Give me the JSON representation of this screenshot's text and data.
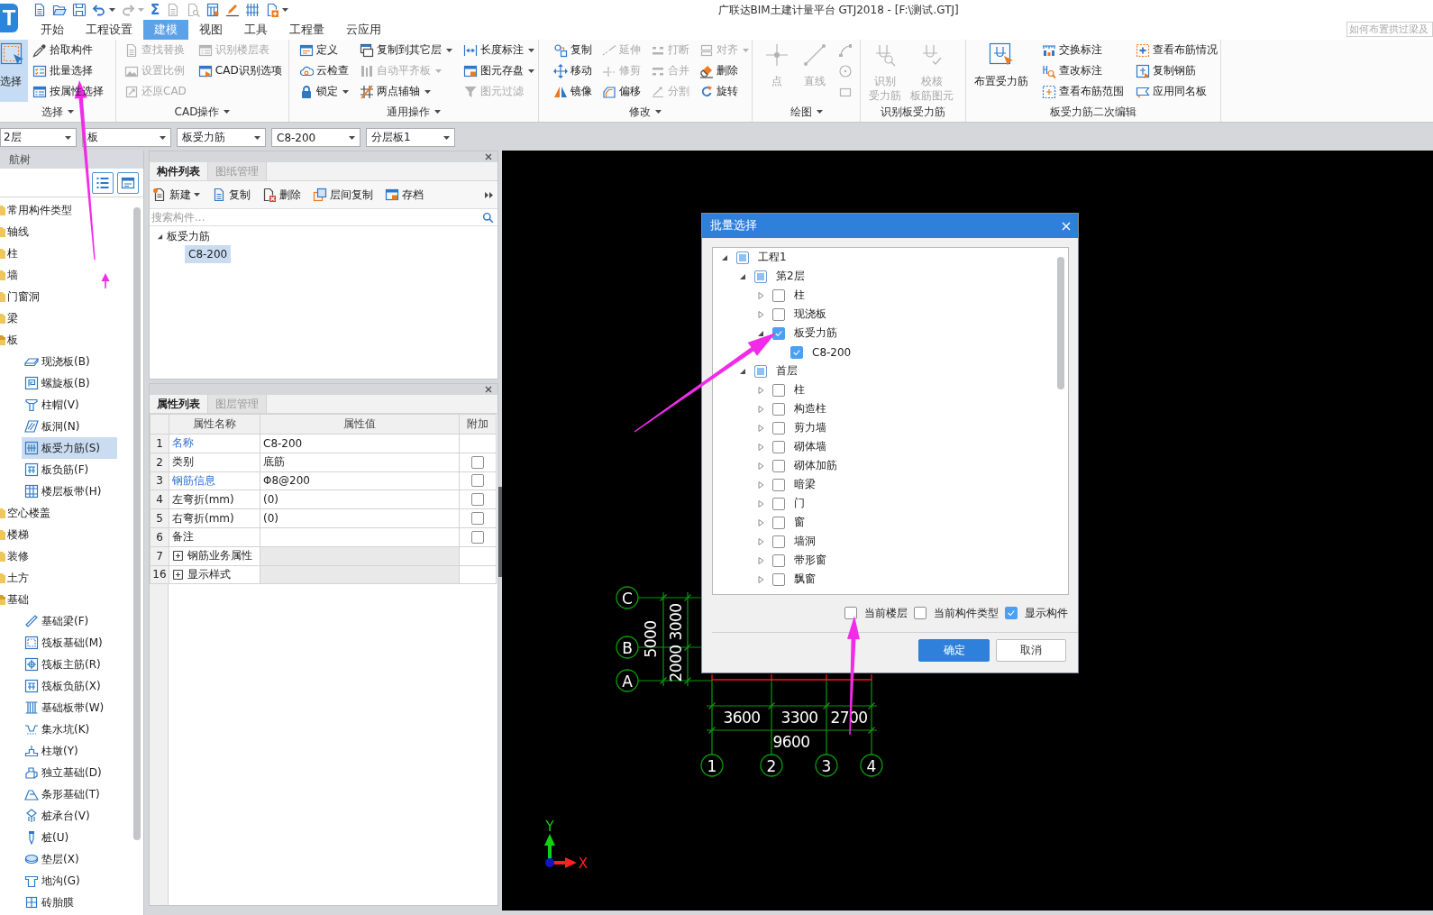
{
  "app": {
    "logo": "T",
    "sum_button": "Σ",
    "title": "广联达BIM土建计量平台 GTJ2018 - [F:\\测试.GTJ]",
    "help_search": {
      "placeholder": "如何布置拱过梁及"
    }
  },
  "tabs": [
    {
      "label": "开始",
      "selected": false
    },
    {
      "label": "工程设置",
      "selected": false
    },
    {
      "label": "建模",
      "selected": true
    },
    {
      "label": "视图",
      "selected": false
    },
    {
      "label": "工具",
      "selected": false
    },
    {
      "label": "工程量",
      "selected": false
    },
    {
      "label": "云应用",
      "selected": false
    }
  ],
  "ribbon": {
    "groups": [
      {
        "title": "选择",
        "dropdown": true,
        "columns": [
          [
            {
              "kind": "large",
              "label": "选择",
              "active": true,
              "disabled": false,
              "dropdown": false
            }
          ],
          [
            {
              "kind": "small",
              "label": "拾取构件",
              "disabled": false,
              "dropdown": false
            },
            {
              "kind": "small",
              "label": "批量选择",
              "disabled": false,
              "dropdown": false
            },
            {
              "kind": "small",
              "label": "按属性选择",
              "disabled": false,
              "dropdown": false
            }
          ]
        ]
      },
      {
        "title": "CAD操作",
        "dropdown": true,
        "columns": [
          [
            {
              "kind": "small",
              "label": "查找替换",
              "disabled": true,
              "dropdown": false
            },
            {
              "kind": "small",
              "label": "设置比例",
              "disabled": true,
              "dropdown": false
            },
            {
              "kind": "small",
              "label": "还原CAD",
              "disabled": true,
              "dropdown": false
            }
          ],
          [
            {
              "kind": "small",
              "label": "识别楼层表",
              "disabled": true,
              "dropdown": false
            },
            {
              "kind": "small",
              "label": "CAD识别选项",
              "disabled": false,
              "dropdown": false
            }
          ]
        ]
      },
      {
        "title": "通用操作",
        "dropdown": true,
        "columns": [
          [
            {
              "kind": "small",
              "label": "定义",
              "disabled": false,
              "dropdown": false
            },
            {
              "kind": "small",
              "label": "云检查",
              "disabled": false,
              "dropdown": false
            },
            {
              "kind": "small",
              "label": "锁定",
              "disabled": false,
              "dropdown": true
            }
          ],
          [
            {
              "kind": "small",
              "label": "复制到其它层",
              "disabled": false,
              "dropdown": true
            },
            {
              "kind": "small",
              "label": "自动平齐板",
              "disabled": true,
              "dropdown": true
            },
            {
              "kind": "small",
              "label": "两点辅轴",
              "disabled": false,
              "dropdown": true
            }
          ],
          [
            {
              "kind": "small",
              "label": "长度标注",
              "disabled": false,
              "dropdown": true
            },
            {
              "kind": "small",
              "label": "图元存盘",
              "disabled": false,
              "dropdown": true
            },
            {
              "kind": "small",
              "label": "图元过滤",
              "disabled": true,
              "dropdown": false
            }
          ]
        ]
      },
      {
        "title": "修改",
        "dropdown": true,
        "columns": [
          [
            {
              "kind": "small",
              "label": "复制",
              "disabled": false,
              "dropdown": false
            },
            {
              "kind": "small",
              "label": "移动",
              "disabled": false,
              "dropdown": false
            },
            {
              "kind": "small",
              "label": "镜像",
              "disabled": false,
              "dropdown": false
            }
          ],
          [
            {
              "kind": "small",
              "label": "延伸",
              "disabled": true,
              "dropdown": false
            },
            {
              "kind": "small",
              "label": "修剪",
              "disabled": true,
              "dropdown": false
            },
            {
              "kind": "small",
              "label": "偏移",
              "disabled": false,
              "dropdown": false
            }
          ],
          [
            {
              "kind": "small",
              "label": "打断",
              "disabled": true,
              "dropdown": false
            },
            {
              "kind": "small",
              "label": "合并",
              "disabled": true,
              "dropdown": false
            },
            {
              "kind": "small",
              "label": "分割",
              "disabled": true,
              "dropdown": false
            }
          ],
          [
            {
              "kind": "small",
              "label": "对齐",
              "disabled": true,
              "dropdown": true
            },
            {
              "kind": "small",
              "label": "删除",
              "disabled": false,
              "dropdown": false
            },
            {
              "kind": "small",
              "label": "旋转",
              "disabled": false,
              "dropdown": false
            }
          ]
        ]
      },
      {
        "title": "绘图",
        "dropdown": true,
        "columns": [
          [
            {
              "kind": "large",
              "label": "点",
              "active": false,
              "disabled": true,
              "dropdown": false
            }
          ],
          [
            {
              "kind": "large",
              "label": "直线",
              "active": false,
              "disabled": true,
              "dropdown": false
            }
          ],
          [
            {
              "kind": "icon",
              "disabled": true
            },
            {
              "kind": "icon",
              "disabled": true
            },
            {
              "kind": "icon",
              "disabled": true
            }
          ]
        ]
      },
      {
        "title": "识别板受力筋",
        "columns": [
          [
            {
              "kind": "large",
              "lines": [
                "识别",
                "受力筋"
              ],
              "active": false,
              "disabled": true,
              "dropdown": false
            }
          ],
          [
            {
              "kind": "large",
              "lines": [
                "校核",
                "板筋图元"
              ],
              "active": false,
              "disabled": true,
              "dropdown": false
            }
          ]
        ]
      },
      {
        "title": "板受力筋二次编辑",
        "columns": [
          [
            {
              "kind": "large",
              "label": "布置受力筋",
              "active": false,
              "disabled": false,
              "dropdown": false
            }
          ],
          [
            {
              "kind": "small",
              "label": "交换标注",
              "disabled": false,
              "dropdown": false
            },
            {
              "kind": "small",
              "label": "查改标注",
              "disabled": false,
              "dropdown": false
            },
            {
              "kind": "small",
              "label": "查看布筋范围",
              "disabled": false,
              "dropdown": false
            }
          ],
          [
            {
              "kind": "small",
              "label": "查看布筋情况",
              "disabled": false,
              "dropdown": false
            },
            {
              "kind": "small",
              "label": "复制钢筋",
              "disabled": false,
              "dropdown": false
            },
            {
              "kind": "small",
              "label": "应用同名板",
              "disabled": false,
              "dropdown": false
            }
          ]
        ]
      }
    ]
  },
  "selectors": [
    {
      "value": "2层"
    },
    {
      "value": "板"
    },
    {
      "value": "板受力筋"
    },
    {
      "value": "C8-200"
    },
    {
      "value": "分层板1"
    }
  ],
  "nav": {
    "title": "航树",
    "items": [
      {
        "label": "常用构件类型",
        "expanded": false,
        "selected": false
      },
      {
        "label": "轴线",
        "expanded": false,
        "selected": false
      },
      {
        "label": "柱",
        "expanded": false,
        "selected": false
      },
      {
        "label": "墙",
        "expanded": false,
        "selected": false
      },
      {
        "label": "门窗洞",
        "expanded": false,
        "selected": false
      },
      {
        "label": "梁",
        "expanded": false,
        "selected": false
      },
      {
        "label": "板",
        "expanded": true,
        "selected": false,
        "children": [
          {
            "label": "现浇板(B)",
            "selected": false
          },
          {
            "label": "螺旋板(B)",
            "selected": false
          },
          {
            "label": "柱帽(V)",
            "selected": false
          },
          {
            "label": "板洞(N)",
            "selected": false
          },
          {
            "label": "板受力筋(S)",
            "selected": true
          },
          {
            "label": "板负筋(F)",
            "selected": false
          },
          {
            "label": "楼层板带(H)",
            "selected": false
          }
        ]
      },
      {
        "label": "空心楼盖",
        "expanded": false,
        "selected": false
      },
      {
        "label": "楼梯",
        "expanded": false,
        "selected": false
      },
      {
        "label": "装修",
        "expanded": false,
        "selected": false
      },
      {
        "label": "土方",
        "expanded": false,
        "selected": false
      },
      {
        "label": "基础",
        "expanded": true,
        "selected": false,
        "children": [
          {
            "label": "基础梁(F)",
            "selected": false
          },
          {
            "label": "筏板基础(M)",
            "selected": false
          },
          {
            "label": "筏板主筋(R)",
            "selected": false
          },
          {
            "label": "筏板负筋(X)",
            "selected": false
          },
          {
            "label": "基础板带(W)",
            "selected": false
          },
          {
            "label": "集水坑(K)",
            "selected": false
          },
          {
            "label": "柱墩(Y)",
            "selected": false
          },
          {
            "label": "独立基础(D)",
            "selected": false
          },
          {
            "label": "条形基础(T)",
            "selected": false
          },
          {
            "label": "桩承台(V)",
            "selected": false
          },
          {
            "label": "桩(U)",
            "selected": false
          },
          {
            "label": "垫层(X)",
            "selected": false
          },
          {
            "label": "地沟(G)",
            "selected": false
          },
          {
            "label": "砖胎膜",
            "selected": false
          }
        ]
      }
    ]
  },
  "component_panel": {
    "tabs": [
      {
        "label": "构件列表",
        "selected": true
      },
      {
        "label": "图纸管理",
        "selected": false
      }
    ],
    "toolbar": [
      {
        "label": "新建",
        "dropdown": true
      },
      {
        "label": "复制",
        "dropdown": false
      },
      {
        "label": "删除",
        "dropdown": false
      },
      {
        "label": "层间复制",
        "dropdown": false
      },
      {
        "label": "存档",
        "dropdown": false
      }
    ],
    "search": {
      "placeholder": "搜索构件..."
    },
    "tree": [
      {
        "label": "板受力筋",
        "expanded": true,
        "selected": false,
        "children": [
          {
            "label": "C8-200",
            "selected": true
          }
        ]
      }
    ]
  },
  "property_panel": {
    "tabs": [
      {
        "label": "属性列表",
        "selected": true
      },
      {
        "label": "图层管理",
        "selected": false
      }
    ],
    "columns": [
      "属性名称",
      "属性值",
      "附加"
    ],
    "rows": [
      {
        "kind": "property",
        "index": "1",
        "name": "名称",
        "public": true,
        "value": "C8-200"
      },
      {
        "kind": "property",
        "index": "2",
        "name": "类别",
        "public": false,
        "value": "底筋",
        "checked": false
      },
      {
        "kind": "property",
        "index": "3",
        "name": "钢筋信息",
        "public": true,
        "value": "Φ8@200",
        "checked": false
      },
      {
        "kind": "property",
        "index": "4",
        "name": "左弯折(mm)",
        "public": false,
        "value": "(0)",
        "checked": false
      },
      {
        "kind": "property",
        "index": "5",
        "name": "右弯折(mm)",
        "public": false,
        "value": "(0)",
        "checked": false
      },
      {
        "kind": "property",
        "index": "6",
        "name": "备注",
        "public": false,
        "checked": false
      },
      {
        "kind": "group",
        "index": "7",
        "name": "钢筋业务属性",
        "expanded": false
      },
      {
        "kind": "group",
        "index": "16",
        "name": "显示样式",
        "expanded": false
      }
    ]
  },
  "drawing": {
    "row_axes": [
      "C",
      "B",
      "A"
    ],
    "column_axes": [
      "1",
      "2",
      "3",
      "4"
    ],
    "vertical_dimensions": [
      "5000",
      "3000",
      "2000"
    ],
    "horizontal_dimensions": [
      "3600",
      "3300",
      "2700",
      "9600"
    ],
    "coordinate_axes": {
      "x": "X",
      "y": "Y"
    }
  },
  "dialog": {
    "title": "批量选择",
    "tree": [
      {
        "label": "工程1",
        "expanded": true,
        "checked": false,
        "partial": true,
        "children": [
          {
            "label": "第2层",
            "expanded": true,
            "checked": false,
            "partial": true,
            "children": [
              {
                "label": "柱",
                "expanded": false,
                "checked": false,
                "partial": false
              },
              {
                "label": "现浇板",
                "expanded": false,
                "checked": false,
                "partial": false
              },
              {
                "label": "板受力筋",
                "expanded": true,
                "checked": true,
                "children": [
                  {
                    "label": "C8-200",
                    "checked": true
                  }
                ]
              }
            ]
          },
          {
            "label": "首层",
            "expanded": true,
            "checked": false,
            "partial": true,
            "children": [
              {
                "label": "柱",
                "expanded": false,
                "checked": false,
                "partial": false
              },
              {
                "label": "构造柱",
                "expanded": false,
                "checked": false,
                "partial": false
              },
              {
                "label": "剪力墙",
                "expanded": false,
                "checked": false,
                "partial": false
              },
              {
                "label": "砌体墙",
                "expanded": false,
                "checked": false,
                "partial": false
              },
              {
                "label": "砌体加筋",
                "expanded": false,
                "checked": false,
                "partial": false
              },
              {
                "label": "暗梁",
                "expanded": false,
                "checked": false,
                "partial": false
              },
              {
                "label": "门",
                "expanded": false,
                "checked": false,
                "partial": false
              },
              {
                "label": "窗",
                "expanded": false,
                "checked": false,
                "partial": false
              },
              {
                "label": "墙洞",
                "expanded": false,
                "checked": false,
                "partial": false
              },
              {
                "label": "带形窗",
                "expanded": false,
                "checked": false,
                "partial": false
              },
              {
                "label": "飘窗",
                "expanded": false,
                "checked": false,
                "partial": false
              }
            ]
          }
        ]
      }
    ],
    "options": [
      {
        "label": "当前楼层",
        "checked": false
      },
      {
        "label": "当前构件类型",
        "checked": false
      },
      {
        "label": "显示构件",
        "checked": true
      }
    ],
    "buttons": [
      {
        "label": "确定",
        "kind": "primary"
      },
      {
        "label": "取消",
        "kind": "secondary"
      }
    ]
  }
}
